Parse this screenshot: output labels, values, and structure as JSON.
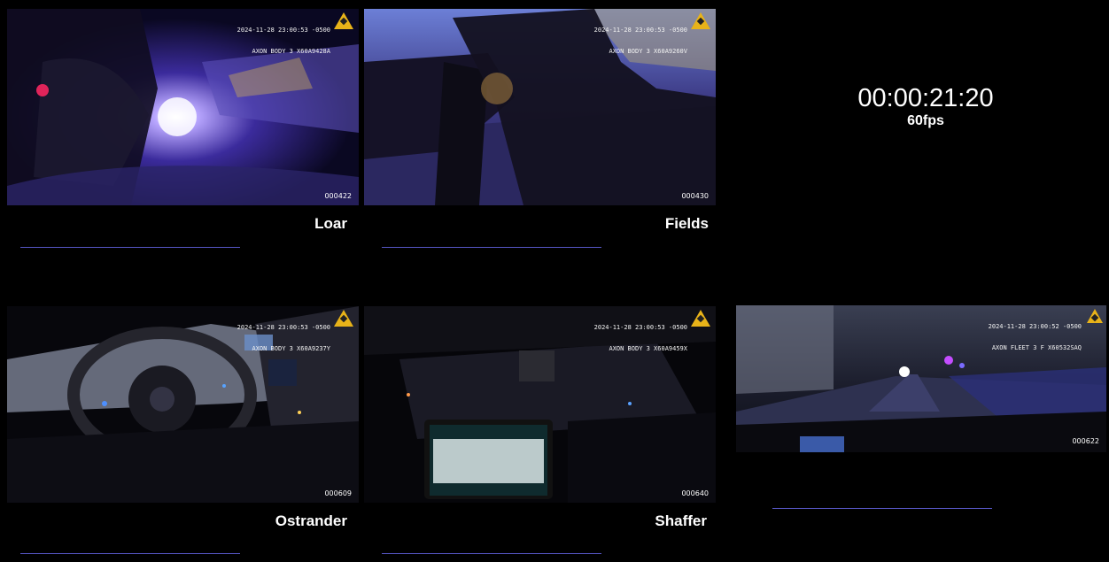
{
  "cameras": [
    {
      "name": "Loar",
      "timestamp": "2024-11-28 23:00:53 -0500",
      "device": "AXON BODY 3 X60A9428A",
      "frame": "000422"
    },
    {
      "name": "Fields",
      "timestamp": "2024-11-28 23:00:53 -0500",
      "device": "AXON BODY 3 X60A9260V",
      "frame": "000430"
    },
    {
      "name": "Ostrander",
      "timestamp": "2024-11-28 23:00:53 -0500",
      "device": "AXON BODY 3 X60A9237Y",
      "frame": "000609"
    },
    {
      "name": "Shaffer",
      "timestamp": "2024-11-28 23:00:53 -0500",
      "device": "AXON BODY 3 X60A9459X",
      "frame": "000640"
    },
    {
      "name": "",
      "timestamp": "2024-11-28 23:00:52 -0500",
      "device": "AXON FLEET 3 F X60532SAQ",
      "frame": "000622"
    }
  ],
  "clock": {
    "timecode": "00:00:21:20",
    "fps": "60fps"
  },
  "colors": {
    "background": "#000000",
    "progress_bar": "#5656c4",
    "axon_logo": "#e8b319"
  }
}
